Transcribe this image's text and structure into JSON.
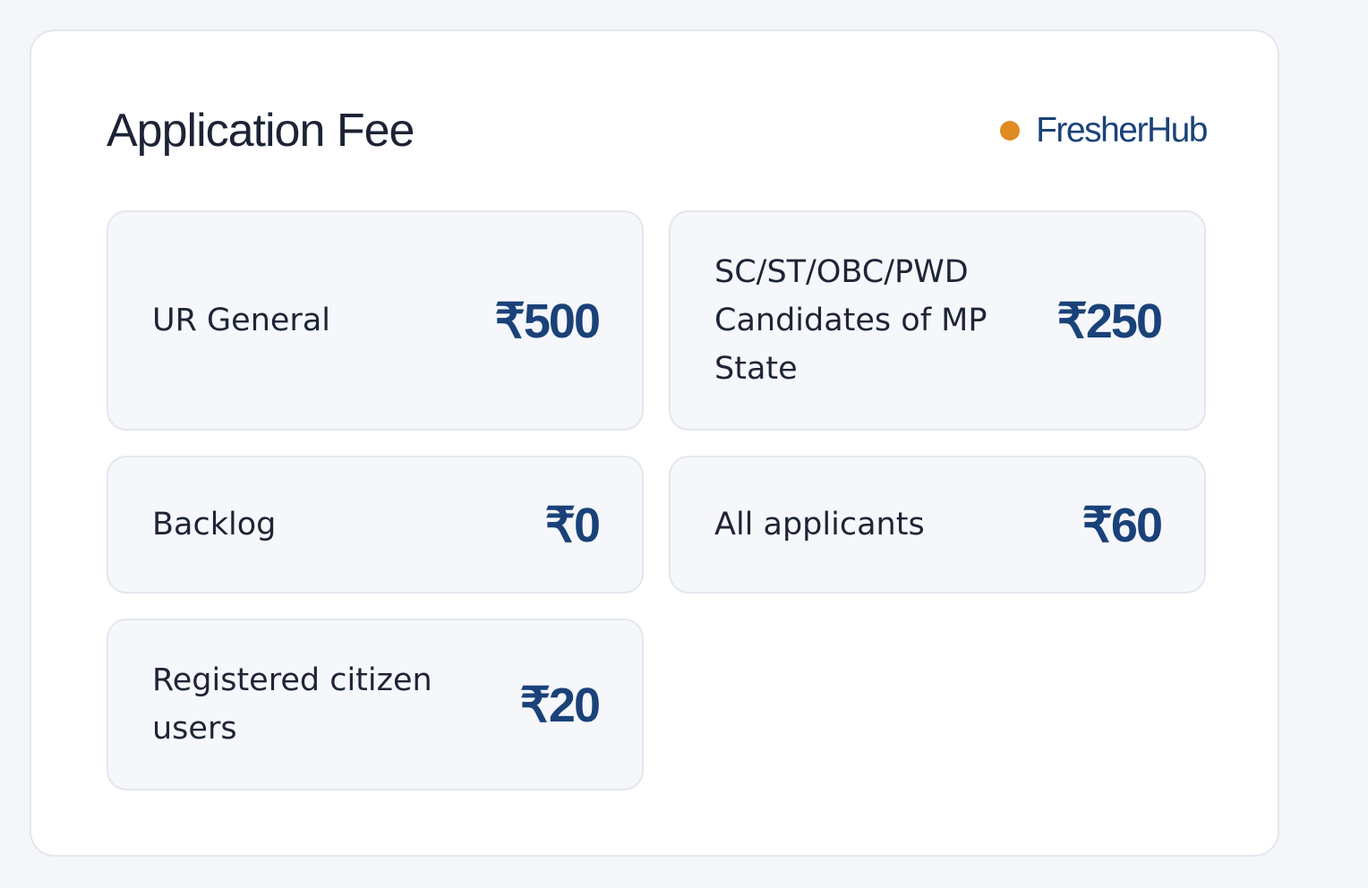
{
  "section": {
    "title": "Application Fee",
    "brand": "FresherHub"
  },
  "colors": {
    "brand_dot": "#e08a24",
    "accent": "#1a4279"
  },
  "fees": [
    {
      "label": "UR General",
      "amount": "₹500"
    },
    {
      "label": "SC/ST/OBC/PWD Candidates of MP State",
      "amount": "₹250"
    },
    {
      "label": "Backlog",
      "amount": "₹0"
    },
    {
      "label": "All applicants",
      "amount": "₹60"
    },
    {
      "label": "Registered citizen users",
      "amount": "₹20"
    }
  ]
}
